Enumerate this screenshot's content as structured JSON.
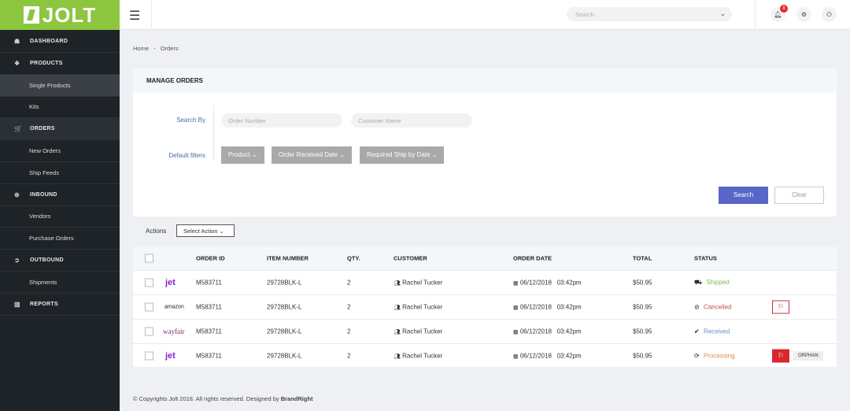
{
  "brand": {
    "logo_text": "JOLT",
    "color": "#8cc63f"
  },
  "sidebar": {
    "items": [
      {
        "label": "DASHBOARD",
        "icon": "dashboard-icon",
        "glyph": "☗"
      },
      {
        "label": "PRODUCTS",
        "icon": "cubes-icon",
        "glyph": "❖"
      },
      {
        "label": "Single Products"
      },
      {
        "label": "Kits"
      },
      {
        "label": "ORDERS",
        "icon": "cart-icon",
        "glyph": "🛒"
      },
      {
        "label": "New Orders"
      },
      {
        "label": "Ship Feeds"
      },
      {
        "label": "INBOUND",
        "icon": "plus-circle-icon",
        "glyph": "⊕"
      },
      {
        "label": "Vendors"
      },
      {
        "label": "Purchase Orders"
      },
      {
        "label": "OUTBOUND",
        "icon": "arrow-circle-icon",
        "glyph": "➲"
      },
      {
        "label": "Shipments"
      },
      {
        "label": "REPORTS",
        "icon": "bar-chart-icon",
        "glyph": "▥"
      }
    ]
  },
  "header": {
    "search_placeholder": "Search",
    "notification_count": "8"
  },
  "breadcrumb": {
    "home": "Home",
    "sep": "-",
    "current": "Orders"
  },
  "manage": {
    "title": "MANAGE ORDERS",
    "search_by": "Search By",
    "order_number_ph": "Order Number",
    "customer_name_ph": "Customer Name",
    "default_filters": "Default filters",
    "filters": [
      "Product",
      "Order Received Date",
      "Required Ship by Date"
    ],
    "search_btn": "Search",
    "clear_btn": "Clear"
  },
  "actions": {
    "label": "Actions",
    "select": "Select Action"
  },
  "table": {
    "headers": [
      "ORDER ID",
      "ITEM NUMBER",
      "QTY.",
      "CUSTOMER",
      "ORDER DATE",
      "TOTAL",
      "STATUS"
    ],
    "rows": [
      {
        "channel": "jet",
        "order_id": "M583711",
        "item": "29728BLK-L",
        "qty": "2",
        "customer": "Rachel Tucker",
        "date": "06/12/2018",
        "time": "03:42pm",
        "total": "$50.95",
        "status": "Shipped",
        "status_color": "#7cc04b",
        "status_glyph": "⛟"
      },
      {
        "channel": "amazon",
        "order_id": "M583711",
        "item": "29728BLK-L",
        "qty": "2",
        "customer": "Rachel Tucker",
        "date": "06/12/2018",
        "time": "03:42pm",
        "total": "$50.95",
        "status": "Cancelled",
        "status_color": "#c0504d",
        "status_glyph": "⊘",
        "flag": "outline"
      },
      {
        "channel": "wayfair",
        "order_id": "M583711",
        "item": "29728BLK-L",
        "qty": "2",
        "customer": "Rachel Tucker",
        "date": "06/12/2018",
        "time": "03:42pm",
        "total": "$50.95",
        "status": "Received",
        "status_color": "#6d8fc9",
        "status_glyph": "✔"
      },
      {
        "channel": "jet",
        "order_id": "M583711",
        "item": "29728BLK-L",
        "qty": "2",
        "customer": "Rachel Tucker",
        "date": "06/12/2018",
        "time": "03:42pm",
        "total": "$50.95",
        "status": "Processing",
        "status_color": "#e08b4a",
        "status_glyph": "⟳",
        "flag": "filled",
        "tag": "ORPHAN"
      }
    ]
  },
  "footer": {
    "text": "© Copyrights Jolt 2018. All rights reserved. Designed by ",
    "brand": "BrandRight"
  }
}
